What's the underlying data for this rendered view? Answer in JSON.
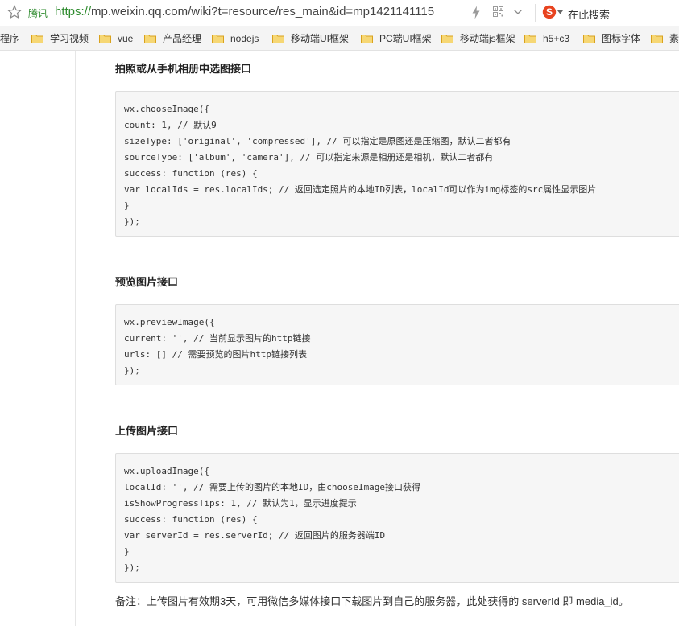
{
  "browser": {
    "site_name": "腾讯",
    "url_protocol": "https://",
    "url_rest": "mp.weixin.qq.com/wiki?t=resource/res_main&id=mp1421141115",
    "search_label": "在此搜索",
    "bookmarks": [
      {
        "label": "程序",
        "has_icon": false
      },
      {
        "label": "学习视频",
        "has_icon": true
      },
      {
        "label": "vue",
        "has_icon": true
      },
      {
        "label": "产品经理",
        "has_icon": true
      },
      {
        "label": "nodejs",
        "has_icon": true
      },
      {
        "label": "移动端UI框架",
        "has_icon": true
      },
      {
        "label": "PC端UI框架",
        "has_icon": true
      },
      {
        "label": "移动端js框架",
        "has_icon": true
      },
      {
        "label": "h5+c3",
        "has_icon": true
      },
      {
        "label": "图标字体",
        "has_icon": true
      },
      {
        "label": "素",
        "has_icon": true
      }
    ]
  },
  "sections": [
    {
      "title": "拍照或从手机相册中选图接口",
      "code": [
        "wx.chooseImage({",
        "count: 1, // 默认9",
        "sizeType: ['original', 'compressed'], // 可以指定是原图还是压缩图，默认二者都有",
        "sourceType: ['album', 'camera'], // 可以指定来源是相册还是相机，默认二者都有",
        "success: function (res) {",
        "var localIds = res.localIds; // 返回选定照片的本地ID列表，localId可以作为img标签的src属性显示图片",
        "}",
        "});"
      ]
    },
    {
      "title": "预览图片接口",
      "code": [
        "wx.previewImage({",
        "current: '', // 当前显示图片的http链接",
        "urls: [] // 需要预览的图片http链接列表",
        "});"
      ]
    },
    {
      "title": "上传图片接口",
      "code": [
        "wx.uploadImage({",
        "localId: '', // 需要上传的图片的本地ID，由chooseImage接口获得",
        "isShowProgressTips: 1, // 默认为1，显示进度提示",
        "success: function (res) {",
        "var serverId = res.serverId; // 返回图片的服务器端ID",
        "}",
        "});"
      ]
    }
  ],
  "note": "备注：上传图片有效期3天，可用微信多媒体接口下载图片到自己的服务器，此处获得的 serverId 即 media_id。",
  "colors": {
    "url_green": "#2e8b2e",
    "sogou_red": "#e8431f",
    "folder_yellow": "#f0c44c"
  }
}
